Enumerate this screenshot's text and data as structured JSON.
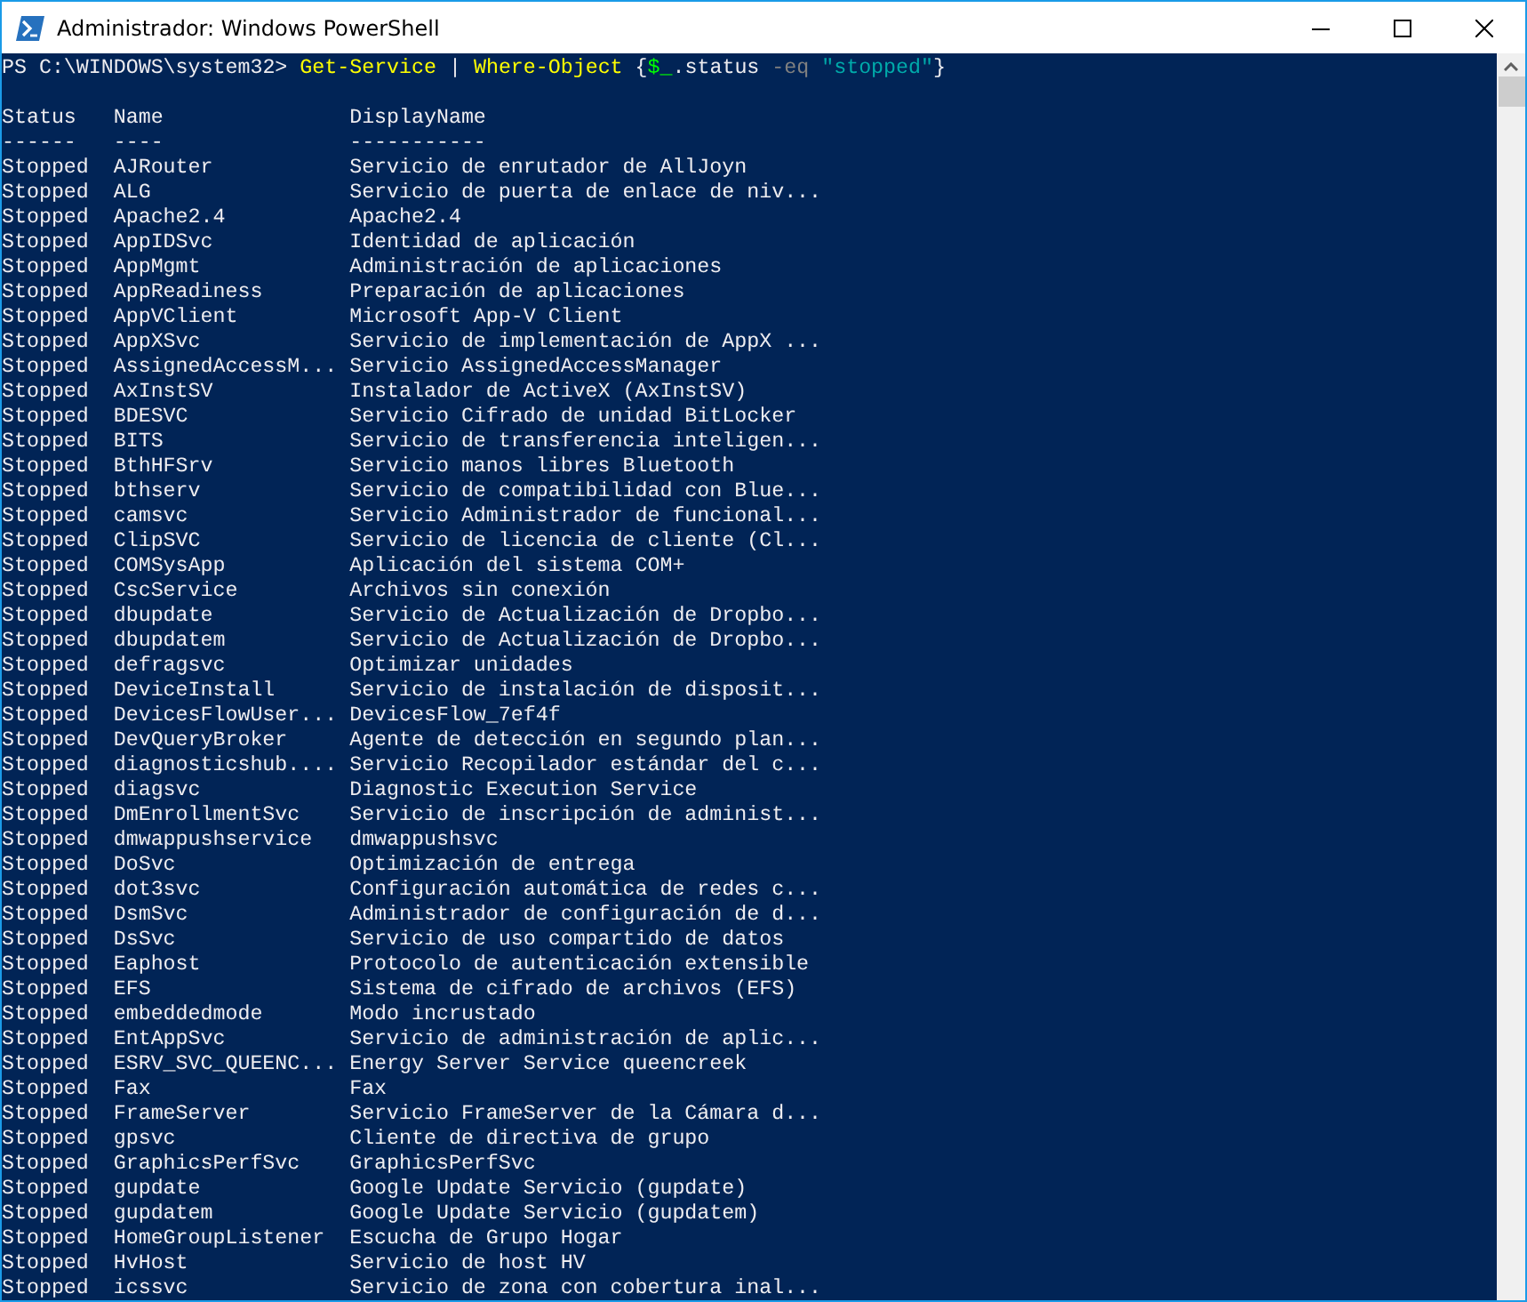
{
  "window": {
    "title": "Administrador: Windows PowerShell"
  },
  "prompt": [
    {
      "kind": "prompt",
      "text": "PS C:\\WINDOWS\\system32> "
    },
    {
      "kind": "command",
      "text": "Get-Service"
    },
    {
      "kind": "plain",
      "text": " | "
    },
    {
      "kind": "command",
      "text": "Where-Object"
    },
    {
      "kind": "plain",
      "text": " {"
    },
    {
      "kind": "variable",
      "text": "$_"
    },
    {
      "kind": "plain",
      "text": ".status "
    },
    {
      "kind": "operator",
      "text": "-eq"
    },
    {
      "kind": "string",
      "text": " \"stopped\""
    },
    {
      "kind": "plain",
      "text": "}"
    }
  ],
  "table": {
    "columns": [
      "Status",
      "Name",
      "DisplayName"
    ],
    "underlines": [
      "------",
      "----",
      "-----------"
    ],
    "rows": [
      [
        "Stopped",
        "AJRouter",
        "Servicio de enrutador de AllJoyn"
      ],
      [
        "Stopped",
        "ALG",
        "Servicio de puerta de enlace de niv..."
      ],
      [
        "Stopped",
        "Apache2.4",
        "Apache2.4"
      ],
      [
        "Stopped",
        "AppIDSvc",
        "Identidad de aplicación"
      ],
      [
        "Stopped",
        "AppMgmt",
        "Administración de aplicaciones"
      ],
      [
        "Stopped",
        "AppReadiness",
        "Preparación de aplicaciones"
      ],
      [
        "Stopped",
        "AppVClient",
        "Microsoft App-V Client"
      ],
      [
        "Stopped",
        "AppXSvc",
        "Servicio de implementación de AppX ..."
      ],
      [
        "Stopped",
        "AssignedAccessM...",
        "Servicio AssignedAccessManager"
      ],
      [
        "Stopped",
        "AxInstSV",
        "Instalador de ActiveX (AxInstSV)"
      ],
      [
        "Stopped",
        "BDESVC",
        "Servicio Cifrado de unidad BitLocker"
      ],
      [
        "Stopped",
        "BITS",
        "Servicio de transferencia inteligen..."
      ],
      [
        "Stopped",
        "BthHFSrv",
        "Servicio manos libres Bluetooth"
      ],
      [
        "Stopped",
        "bthserv",
        "Servicio de compatibilidad con Blue..."
      ],
      [
        "Stopped",
        "camsvc",
        "Servicio Administrador de funcional..."
      ],
      [
        "Stopped",
        "ClipSVC",
        "Servicio de licencia de cliente (Cl..."
      ],
      [
        "Stopped",
        "COMSysApp",
        "Aplicación del sistema COM+"
      ],
      [
        "Stopped",
        "CscService",
        "Archivos sin conexión"
      ],
      [
        "Stopped",
        "dbupdate",
        "Servicio de Actualización de Dropbo..."
      ],
      [
        "Stopped",
        "dbupdatem",
        "Servicio de Actualización de Dropbo..."
      ],
      [
        "Stopped",
        "defragsvc",
        "Optimizar unidades"
      ],
      [
        "Stopped",
        "DeviceInstall",
        "Servicio de instalación de disposit..."
      ],
      [
        "Stopped",
        "DevicesFlowUser...",
        "DevicesFlow_7ef4f"
      ],
      [
        "Stopped",
        "DevQueryBroker",
        "Agente de detección en segundo plan..."
      ],
      [
        "Stopped",
        "diagnosticshub....",
        "Servicio Recopilador estándar del c..."
      ],
      [
        "Stopped",
        "diagsvc",
        "Diagnostic Execution Service"
      ],
      [
        "Stopped",
        "DmEnrollmentSvc",
        "Servicio de inscripción de administ..."
      ],
      [
        "Stopped",
        "dmwappushservice",
        "dmwappushsvc"
      ],
      [
        "Stopped",
        "DoSvc",
        "Optimización de entrega"
      ],
      [
        "Stopped",
        "dot3svc",
        "Configuración automática de redes c..."
      ],
      [
        "Stopped",
        "DsmSvc",
        "Administrador de configuración de d..."
      ],
      [
        "Stopped",
        "DsSvc",
        "Servicio de uso compartido de datos"
      ],
      [
        "Stopped",
        "Eaphost",
        "Protocolo de autenticación extensible"
      ],
      [
        "Stopped",
        "EFS",
        "Sistema de cifrado de archivos (EFS)"
      ],
      [
        "Stopped",
        "embeddedmode",
        "Modo incrustado"
      ],
      [
        "Stopped",
        "EntAppSvc",
        "Servicio de administración de aplic..."
      ],
      [
        "Stopped",
        "ESRV_SVC_QUEENC...",
        "Energy Server Service queencreek"
      ],
      [
        "Stopped",
        "Fax",
        "Fax"
      ],
      [
        "Stopped",
        "FrameServer",
        "Servicio FrameServer de la Cámara d..."
      ],
      [
        "Stopped",
        "gpsvc",
        "Cliente de directiva de grupo"
      ],
      [
        "Stopped",
        "GraphicsPerfSvc",
        "GraphicsPerfSvc"
      ],
      [
        "Stopped",
        "gupdate",
        "Google Update Servicio (gupdate)"
      ],
      [
        "Stopped",
        "gupdatem",
        "Google Update Servicio (gupdatem)"
      ],
      [
        "Stopped",
        "HomeGroupListener",
        "Escucha de Grupo Hogar"
      ],
      [
        "Stopped",
        "HvHost",
        "Servicio de host HV"
      ],
      [
        "Stopped",
        "icssvc",
        "Servicio de zona con cobertura inal..."
      ]
    ]
  }
}
